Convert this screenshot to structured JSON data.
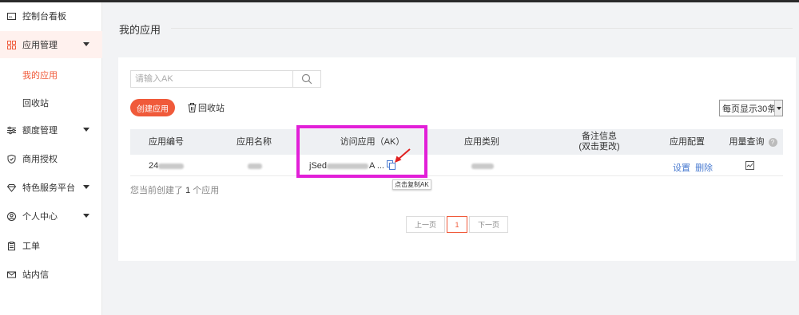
{
  "sidebar": {
    "items": [
      {
        "label": "控制台看板"
      },
      {
        "label": "应用管理"
      },
      {
        "label": "额度管理"
      },
      {
        "label": "商用授权"
      },
      {
        "label": "特色服务平台"
      },
      {
        "label": "个人中心"
      },
      {
        "label": "工单"
      },
      {
        "label": "站内信"
      }
    ],
    "sub_items": [
      {
        "label": "我的应用"
      },
      {
        "label": "回收站"
      }
    ]
  },
  "page": {
    "title": "我的应用"
  },
  "search": {
    "placeholder": "请输入AK",
    "value": ""
  },
  "toolbar": {
    "create_label": "创建应用",
    "recycle_label": "回收站",
    "page_size_label": "每页显示30条"
  },
  "table": {
    "headers": {
      "app_id": "应用编号",
      "app_name": "应用名称",
      "ak": "访问应用（AK）",
      "category": "应用类别",
      "remark_line1": "备注信息",
      "remark_line2": "(双击更改)",
      "config": "应用配置",
      "usage": "用量查询"
    },
    "rows": [
      {
        "app_id": "24",
        "ak": "jSed",
        "ak_suffix": "A ...",
        "config_settings": "设置",
        "config_delete": "删除"
      }
    ],
    "copy_tooltip": "点击复制AK"
  },
  "summary": {
    "prefix": "您当前创建了",
    "count": "1",
    "suffix": "个应用"
  },
  "pagination": {
    "prev": "上一页",
    "current": "1",
    "next": "下一页"
  },
  "colors": {
    "accent": "#f05a3a",
    "highlight": "#e21fd8",
    "link": "#4a7bd0"
  }
}
